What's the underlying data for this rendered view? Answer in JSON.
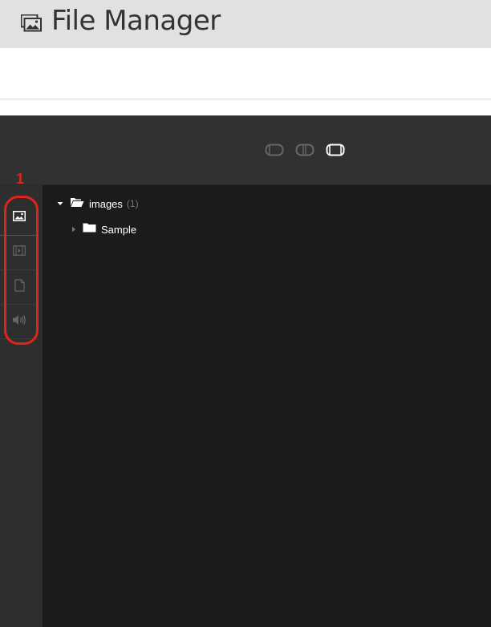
{
  "header": {
    "title": "File Manager",
    "icon": "image-icon"
  },
  "annotation": {
    "marker": "1",
    "color": "#e2231a"
  },
  "toolbar": {
    "layout_buttons": [
      {
        "name": "layout-single-icon",
        "active": false
      },
      {
        "name": "layout-split-icon",
        "active": false
      },
      {
        "name": "layout-full-icon",
        "active": true
      }
    ]
  },
  "rail": {
    "items": [
      {
        "name": "images-icon",
        "active": true
      },
      {
        "name": "video-icon",
        "active": false
      },
      {
        "name": "document-icon",
        "active": false
      },
      {
        "name": "audio-icon",
        "active": false
      }
    ]
  },
  "tree": {
    "root": {
      "label": "images",
      "count": "(1)",
      "expanded": true
    },
    "children": [
      {
        "label": "Sample",
        "expanded": false
      }
    ]
  },
  "colors": {
    "header_bg": "#e1e1e1",
    "app_bg": "#1b1b1b",
    "toolbar_bg": "#313131",
    "rail_bg": "#2e2e2e",
    "active_accent": "#2f6b52"
  }
}
